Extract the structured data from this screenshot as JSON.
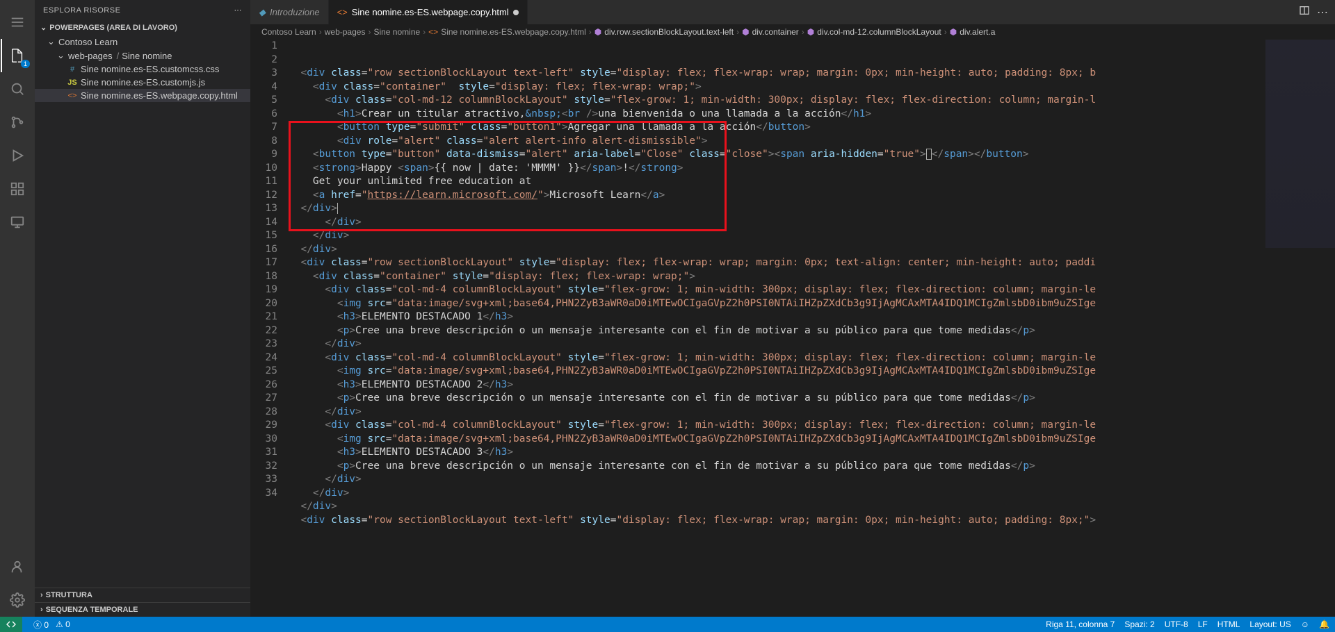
{
  "sidebar": {
    "title": "ESPLORA RISORSE",
    "workspace_section": "POWERPAGES (AREA DI LAVORO)",
    "tree": {
      "root": "Contoso Learn",
      "folder_web": "web-pages",
      "folder_sine": "Sine nomine",
      "file_css": "Sine nomine.es-ES.customcss.css",
      "file_js": "Sine nomine.es-ES.customjs.js",
      "file_html": "Sine nomine.es-ES.webpage.copy.html"
    },
    "outline_section": "STRUTTURA",
    "timeline_section": "SEQUENZA TEMPORALE"
  },
  "tabs": {
    "t1": "Introduzione",
    "t2": "Sine nomine.es-ES.webpage.copy.html"
  },
  "breadcrumbs": {
    "p1": "Contoso Learn",
    "p2": "web-pages",
    "p3": "Sine nomine",
    "p4": "Sine nomine.es-ES.webpage.copy.html",
    "p5": "div.row.sectionBlockLayout.text-left",
    "p6": "div.container",
    "p7": "div.col-md-12.columnBlockLayout",
    "p8": "div.alert.a"
  },
  "lines": [
    "1",
    "2",
    "3",
    "4",
    "5",
    "6",
    "7",
    "8",
    "9",
    "10",
    "11",
    "12",
    "13",
    "14",
    "15",
    "16",
    "17",
    "18",
    "19",
    "20",
    "21",
    "22",
    "23",
    "24",
    "25",
    "26",
    "27",
    "28",
    "29",
    "30",
    "31",
    "32",
    "33",
    "34"
  ],
  "statusbar": {
    "errors": "0",
    "warnings": "0",
    "pos": "Riga 11, colonna 7",
    "spaces": "Spazi: 2",
    "encoding": "UTF-8",
    "eol": "LF",
    "lang": "HTML",
    "layout": "Layout: US"
  }
}
